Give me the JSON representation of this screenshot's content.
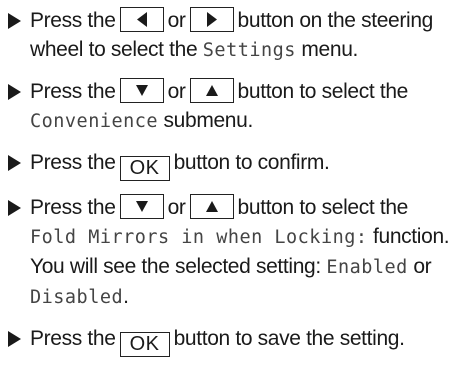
{
  "steps": [
    {
      "pre": "Press the",
      "key1": "left-triangle-icon",
      "mid": "or",
      "key2": "right-triangle-icon",
      "post": "button on the steering wheel to select the",
      "code": "Settings",
      "tail": "menu."
    },
    {
      "pre": "Press the",
      "key1": "down-triangle-icon",
      "mid": "or",
      "key2": "up-triangle-icon",
      "post": "button to select the",
      "code": "Convenience",
      "tail": "submenu."
    },
    {
      "pre": "Press the",
      "key_label": "OK",
      "post": "button to confirm."
    },
    {
      "pre": "Press the",
      "key1": "down-triangle-icon",
      "mid": "or",
      "key2": "up-triangle-icon",
      "post": "button to select the",
      "code": "Fold Mirrors in when Locking:",
      "tail": "function.",
      "note_pre": "You will see the selected setting:",
      "note_code1": "Enabled",
      "note_or": "or",
      "note_code2": "Disabled",
      "note_end": "."
    },
    {
      "pre": "Press the",
      "key_label": "OK",
      "post": "button to save the setting."
    }
  ]
}
